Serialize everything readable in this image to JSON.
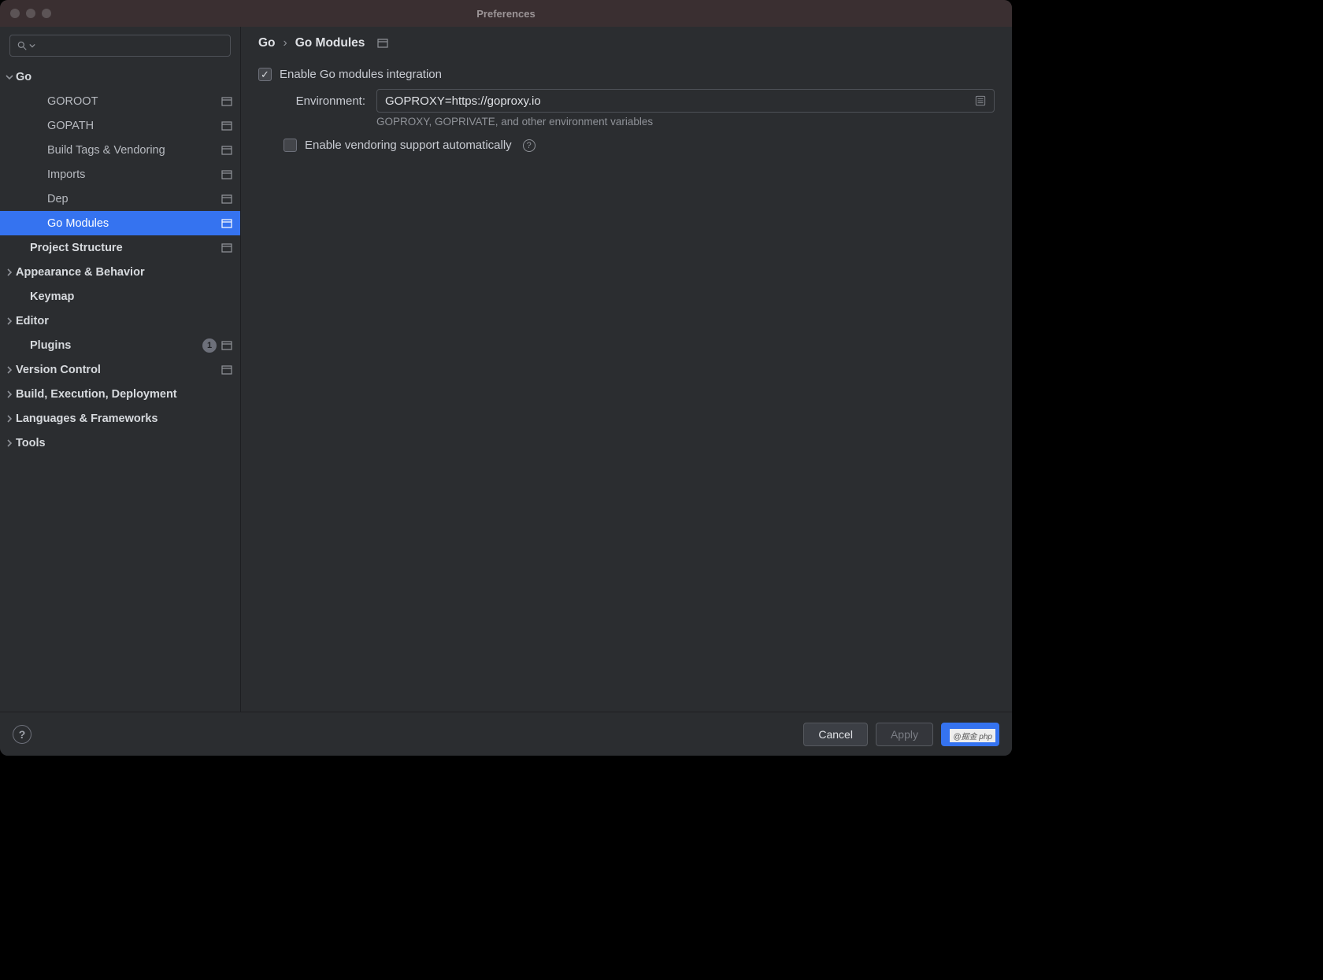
{
  "window_title": "Preferences",
  "search_placeholder": "",
  "sidebar": {
    "items": [
      {
        "label": "Go",
        "bold": true,
        "level": 0,
        "chev": "down"
      },
      {
        "label": "GOROOT",
        "level": 2,
        "proj": true
      },
      {
        "label": "GOPATH",
        "level": 2,
        "proj": true
      },
      {
        "label": "Build Tags & Vendoring",
        "level": 2,
        "proj": true
      },
      {
        "label": "Imports",
        "level": 2,
        "proj": true
      },
      {
        "label": "Dep",
        "level": 2,
        "proj": true
      },
      {
        "label": "Go Modules",
        "level": 2,
        "proj": true,
        "selected": true
      },
      {
        "label": "Project Structure",
        "bold": true,
        "level": 1,
        "proj": true
      },
      {
        "label": "Appearance & Behavior",
        "bold": true,
        "level": 0,
        "chev": "right"
      },
      {
        "label": "Keymap",
        "bold": true,
        "level": 1
      },
      {
        "label": "Editor",
        "bold": true,
        "level": 0,
        "chev": "right"
      },
      {
        "label": "Plugins",
        "bold": true,
        "level": 1,
        "badge": "1",
        "proj": true
      },
      {
        "label": "Version Control",
        "bold": true,
        "level": 0,
        "chev": "right",
        "proj": true
      },
      {
        "label": "Build, Execution, Deployment",
        "bold": true,
        "level": 0,
        "chev": "right"
      },
      {
        "label": "Languages & Frameworks",
        "bold": true,
        "level": 0,
        "chev": "right"
      },
      {
        "label": "Tools",
        "bold": true,
        "level": 0,
        "chev": "right"
      }
    ]
  },
  "breadcrumb": {
    "root": "Go",
    "leaf": "Go Modules"
  },
  "main": {
    "enable_label": "Enable Go modules integration",
    "enable_checked": true,
    "env_label": "Environment:",
    "env_value": "GOPROXY=https://goproxy.io",
    "env_hint": "GOPROXY, GOPRIVATE, and other environment variables",
    "vendoring_label": "Enable vendoring support automatically",
    "vendoring_checked": false
  },
  "footer": {
    "cancel": "Cancel",
    "apply": "Apply",
    "ok": ""
  },
  "watermark": "@掘金 php"
}
